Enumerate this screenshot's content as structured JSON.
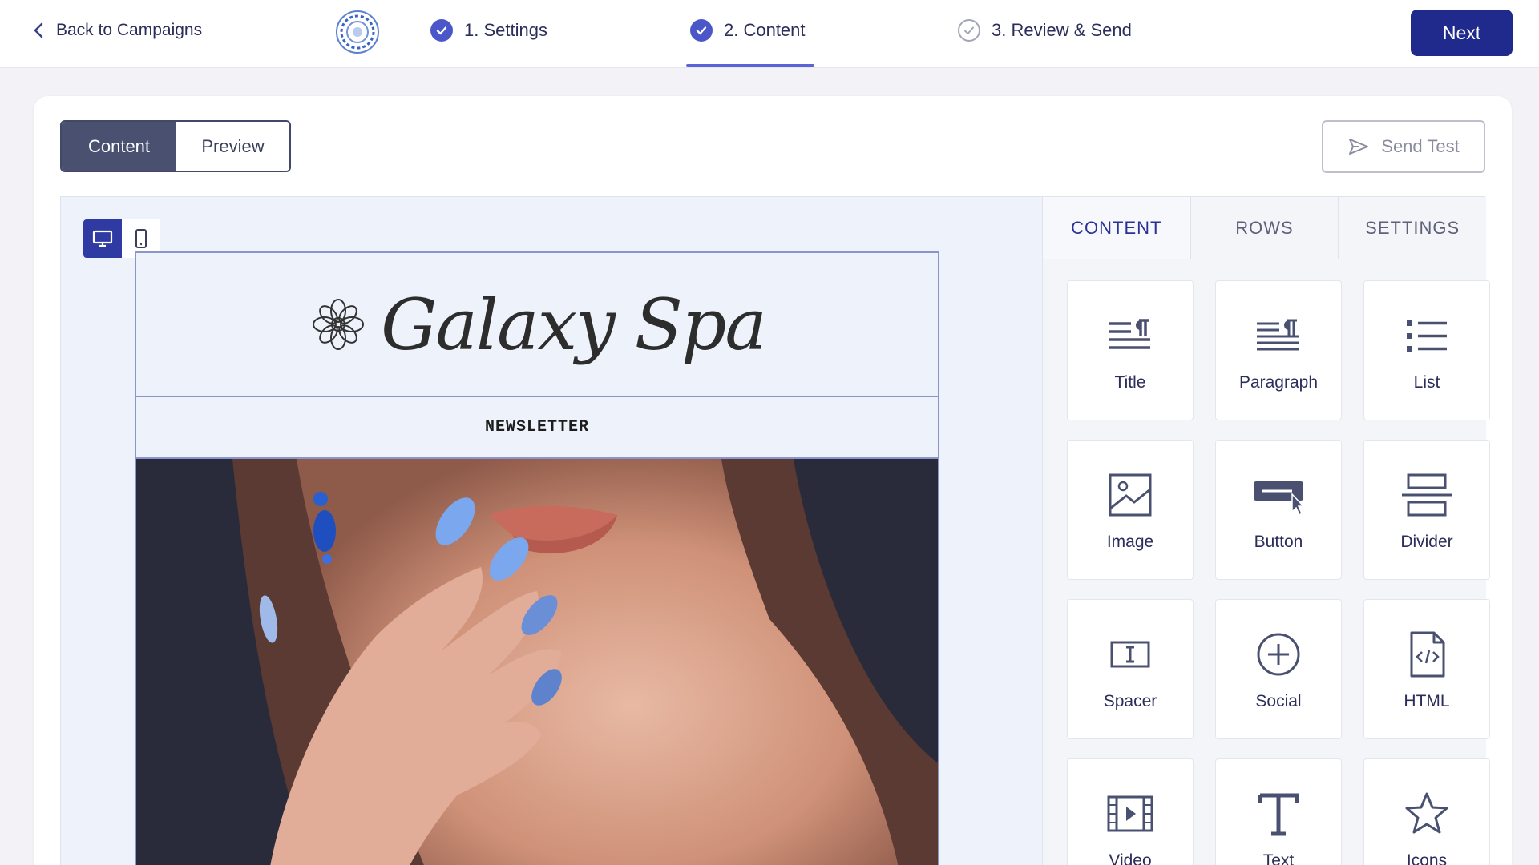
{
  "topbar": {
    "back_label": "Back to Campaigns",
    "steps": [
      {
        "label": "1. Settings",
        "state": "done"
      },
      {
        "label": "2. Content",
        "state": "done"
      },
      {
        "label": "3. Review & Send",
        "state": "todo"
      }
    ],
    "active_step": 2,
    "next_label": "Next"
  },
  "toolbar": {
    "mode_tabs": [
      "Content",
      "Preview"
    ],
    "active_mode": "Content",
    "send_test_label": "Send Test"
  },
  "email": {
    "brand": "Galaxy Spa",
    "section_label": "NEWSLETTER",
    "view_mode": "desktop"
  },
  "panel": {
    "tabs": [
      "CONTENT",
      "ROWS",
      "SETTINGS"
    ],
    "active_tab": "CONTENT",
    "tiles": [
      {
        "label": "Title",
        "icon": "title-icon"
      },
      {
        "label": "Paragraph",
        "icon": "paragraph-icon"
      },
      {
        "label": "List",
        "icon": "list-icon"
      },
      {
        "label": "Image",
        "icon": "image-icon"
      },
      {
        "label": "Button",
        "icon": "button-icon"
      },
      {
        "label": "Divider",
        "icon": "divider-icon"
      },
      {
        "label": "Spacer",
        "icon": "spacer-icon"
      },
      {
        "label": "Social",
        "icon": "social-icon"
      },
      {
        "label": "HTML",
        "icon": "html-icon"
      },
      {
        "label": "Video",
        "icon": "video-icon"
      },
      {
        "label": "Text",
        "icon": "text-icon"
      },
      {
        "label": "Icons",
        "icon": "icons-icon"
      }
    ]
  },
  "colors": {
    "primary": "#1f2a8c",
    "accent": "#4b57c9",
    "editor_bg": "#eef3fb"
  }
}
